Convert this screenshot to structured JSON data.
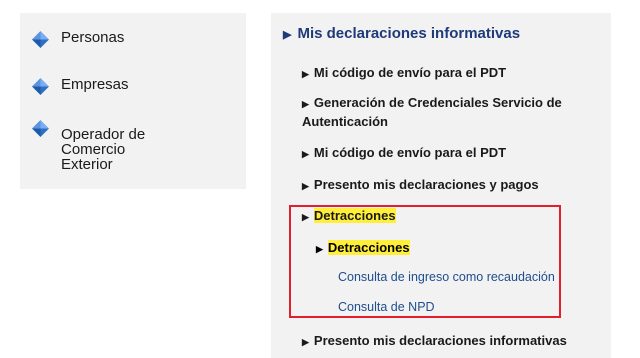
{
  "sidebar": {
    "items": [
      {
        "label": "Personas",
        "icon": "diamond-icon"
      },
      {
        "label": "Empresas",
        "icon": "diamond-icon"
      },
      {
        "label_lines": [
          "Operador de",
          "Comercio",
          "Exterior"
        ],
        "icon": "diamond-icon"
      }
    ]
  },
  "menu": {
    "header": "Mis declaraciones informativas",
    "items": [
      {
        "label": "Mi código de envío para el PDT"
      },
      {
        "label_lines": [
          "Generación de Credenciales Servicio de",
          "Autenticación"
        ]
      },
      {
        "label": "Mi código de envío para el PDT"
      },
      {
        "label": "Presento mis declaraciones y pagos"
      },
      {
        "label": "Detracciones"
      },
      {
        "label": "Detracciones"
      },
      {
        "label": "Consulta de ingreso como recaudación"
      },
      {
        "label": "Consulta de NPD"
      },
      {
        "label": "Presento mis declaraciones informativas"
      }
    ]
  },
  "colors": {
    "highlight": "#ffef3a",
    "annotation_box": "#e0202e",
    "header_text": "#1f3a7a",
    "link_text": "#1f4d8f",
    "icon_light": "#7aaef0",
    "icon_dark": "#1d5aa8"
  }
}
